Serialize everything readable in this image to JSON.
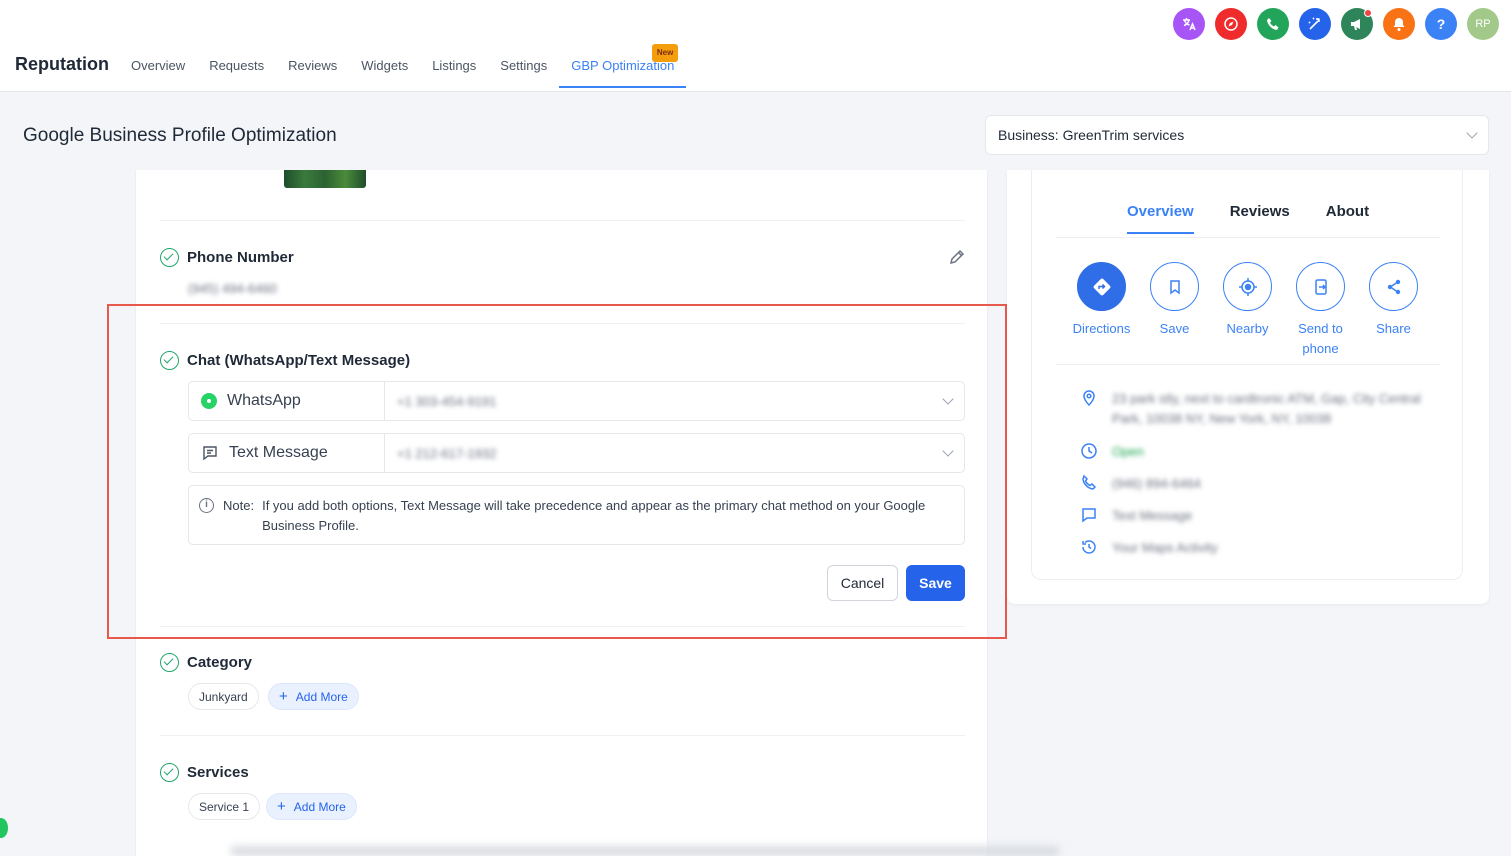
{
  "nav": {
    "brand": "Reputation",
    "tabs": [
      {
        "label": "Overview"
      },
      {
        "label": "Requests"
      },
      {
        "label": "Reviews"
      },
      {
        "label": "Widgets"
      },
      {
        "label": "Listings"
      },
      {
        "label": "Settings"
      },
      {
        "label": "GBP Optimization",
        "badge": "New"
      }
    ],
    "avatar_initials": "RP",
    "help_label": "?"
  },
  "header": {
    "title": "Google Business Profile Optimization",
    "business_select": "Business: GreenTrim services"
  },
  "phone": {
    "title": "Phone Number",
    "value": "(945) 494-6460"
  },
  "chat": {
    "title": "Chat (WhatsApp/Text Message)",
    "whatsapp_label": "WhatsApp",
    "whatsapp_value": "+1 303-454-9191",
    "text_label": "Text Message",
    "text_value": "+1 212-617-1932",
    "note_prefix": "Note:",
    "note_text": "If you add both options, Text Message will take precedence and appear as the primary chat method on your Google Business Profile.",
    "cancel_label": "Cancel",
    "save_label": "Save"
  },
  "category": {
    "title": "Category",
    "chip": "Junkyard",
    "add_more": "Add More"
  },
  "services": {
    "title": "Services",
    "chip": "Service 1",
    "add_more": "Add More"
  },
  "preview": {
    "tabs": [
      "Overview",
      "Reviews",
      "About"
    ],
    "actions": [
      "Directions",
      "Save",
      "Nearby",
      "Send to phone",
      "Share"
    ],
    "address": "23 park stly, next to cardtronic ATM, Gap, City Central Park, 10038 NY, New York, NY, 10038",
    "status": "Open",
    "phone": "(946) 894-6464",
    "text_message": "Text Message",
    "activity": "Your Maps Activity"
  },
  "colors": {
    "accent": "#3b82f6",
    "primary_button": "#2563eb",
    "success": "#22a56a",
    "highlight": "#e8594c"
  }
}
